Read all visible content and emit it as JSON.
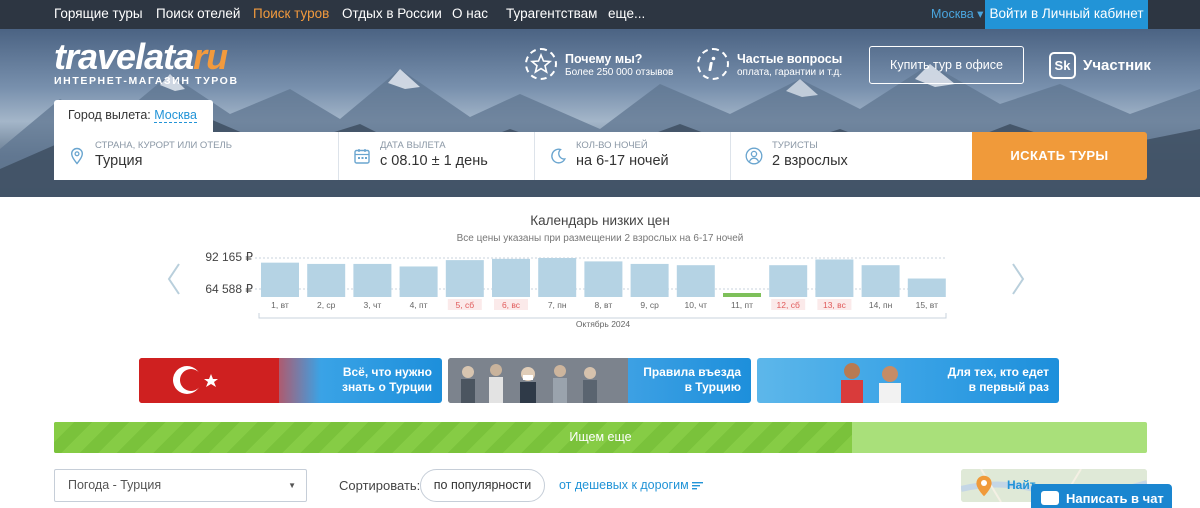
{
  "topnav": {
    "items": [
      "Горящие туры",
      "Поиск отелей",
      "Поиск туров",
      "Отдых в России",
      "О нас",
      "Турагентствам",
      "еще..."
    ],
    "active_index": 2,
    "city": "Москва ▾",
    "login": "Войти в Личный кабинет"
  },
  "header": {
    "logo_word_main": "travelata",
    "logo_word_ru": "ru",
    "logo_tagline": "ИНТЕРНЕТ-МАГАЗИН ТУРОВ",
    "why_title": "Почему мы?",
    "why_sub": "Более 250 000 отзывов",
    "faq_title": "Частые вопросы",
    "faq_sub": "оплата, гарантии и т.д.",
    "office_button": "Купить тур в офисе",
    "sk_badge": "Sk",
    "sk_label": "Участник"
  },
  "search": {
    "departure_label": "Город вылета:",
    "departure_city": "Москва",
    "destination_label": "СТРАНА, КУРОРТ ИЛИ ОТЕЛЬ",
    "destination_value": "Турция",
    "date_label": "ДАТА ВЫЛЕТА",
    "date_value": "с 08.10 ± 1 день",
    "nights_label": "КОЛ-ВО НОЧЕЙ",
    "nights_value": "на 6-17 ночей",
    "tourists_label": "ТУРИСТЫ",
    "tourists_value": "2 взрослых",
    "button": "ИСКАТЬ ТУРЫ"
  },
  "calendar": {
    "title": "Календарь низких цен",
    "subtitle": "Все цены указаны при размещении 2 взрослых на 6-17 ночей",
    "price_max": "92 165 ₽",
    "price_min": "64 588 ₽",
    "month": "Октябрь 2024"
  },
  "chart_data": {
    "type": "bar",
    "categories": [
      "1, вт",
      "2, ср",
      "3, чт",
      "4, пт",
      "5, сб",
      "6, вс",
      "7, пн",
      "8, вт",
      "9, ср",
      "10, чт",
      "11, пт",
      "12, сб",
      "13, вс",
      "14, пн",
      "15, вт"
    ],
    "values": [
      88500,
      87500,
      87500,
      85500,
      90500,
      91500,
      92165,
      89500,
      87500,
      86500,
      64588,
      86500,
      91000,
      86500,
      76000
    ],
    "weekend_indices": [
      4,
      5,
      11,
      12
    ],
    "highlight_index": 10,
    "ylim": [
      64588,
      92165
    ],
    "colors": {
      "bar": "#b5d3e4",
      "highlight": "#7ec05a",
      "weekend_label": "#e05a5a",
      "label": "#666666"
    }
  },
  "banners": [
    {
      "line1": "Всё, что нужно",
      "line2": "знать о Турции"
    },
    {
      "line1": "Правила въезда",
      "line2": "в Турцию"
    },
    {
      "line1": "Для тех, кто едет",
      "line2": "в первый раз"
    }
  ],
  "progress": {
    "label": "Ищем еще",
    "fraction": 0.73
  },
  "controls": {
    "weather": "Погода - Турция",
    "sort_label": "Сортировать:",
    "sort_value": "по популярности",
    "sort_link": "от дешевых к дорогим",
    "map_label": "Найт",
    "chat": "Написать в чат"
  },
  "colors": {
    "accent_orange": "#f09a3a",
    "link_blue": "#2294d7",
    "nav_bg": "#2d3642"
  }
}
